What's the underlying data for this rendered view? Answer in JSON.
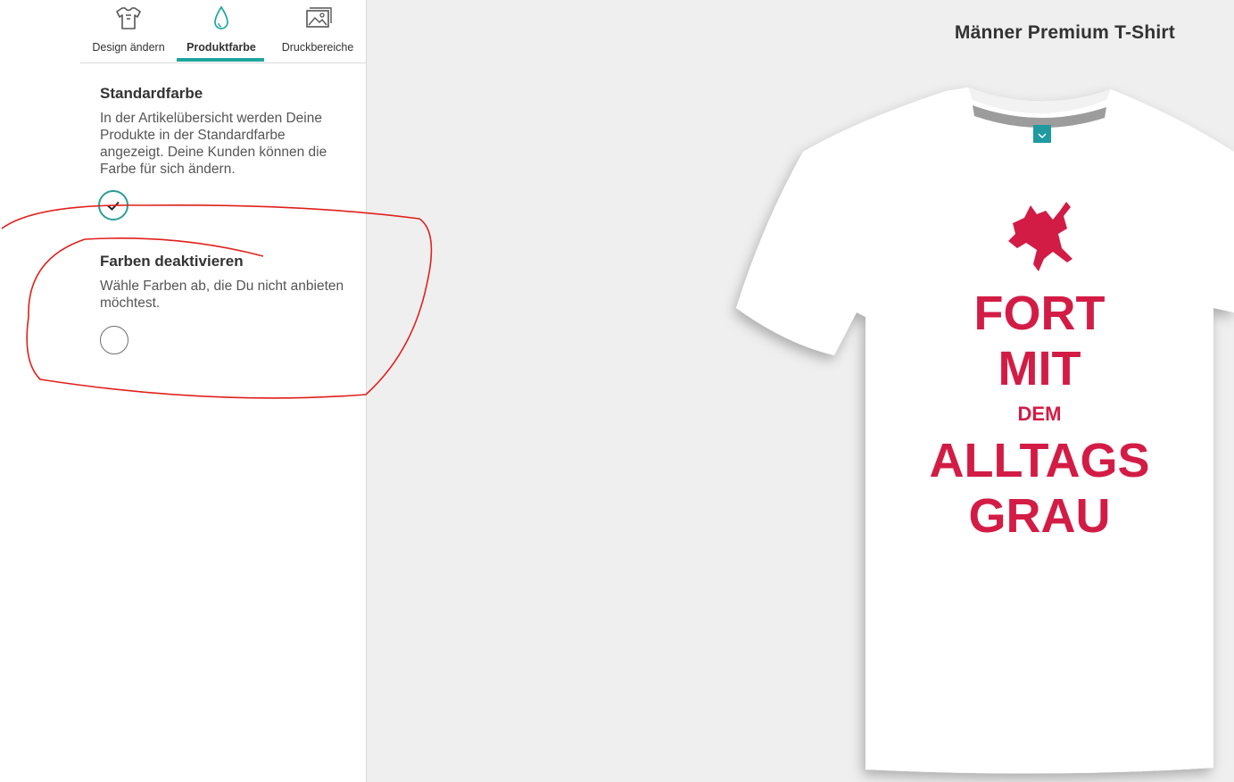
{
  "tabs": [
    {
      "label": "Design ändern",
      "icon": "tshirt-icon"
    },
    {
      "label": "Produktfarbe",
      "icon": "color-drop-icon",
      "active": true
    },
    {
      "label": "Druckbereiche",
      "icon": "image-gallery-icon"
    }
  ],
  "default_color": {
    "title": "Standardfarbe",
    "description": "In der Artikelübersicht werden Deine Produkte in der Standardfarbe angezeigt. Deine Kunden können die Farbe für sich ändern.",
    "swatch_color": "#ffffff",
    "selected": true
  },
  "disable_colors": {
    "title": "Farben deaktivieren",
    "description": "Wähle Farben ab, die Du nicht anbieten möchtest.",
    "swatch_color": "#ffffff",
    "selected": false
  },
  "preview": {
    "product_title": "Männer Premium T-Shirt",
    "print_lines": [
      "FORT",
      "MIT",
      "DEM",
      "ALLTAGS",
      "GRAU"
    ],
    "shirt_color": "#ffffff",
    "print_color": "#d31c45"
  },
  "colors": {
    "accent": "#1fa6a0",
    "annotation": "#e0201b"
  }
}
